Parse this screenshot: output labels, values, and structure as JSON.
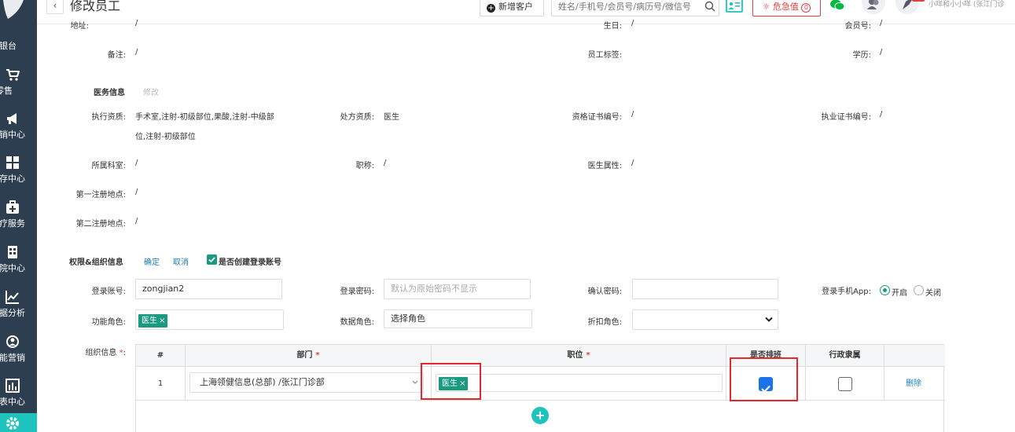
{
  "sidebar": {
    "items": [
      {
        "label": "收银台",
        "icon": "cashier-icon"
      },
      {
        "label": "零售",
        "icon": "cart-icon"
      },
      {
        "label": "营销中心",
        "icon": "megaphone-icon"
      },
      {
        "label": "库存中心",
        "icon": "grid-icon"
      },
      {
        "label": "医疗服务",
        "icon": "medkit-icon"
      },
      {
        "label": "住院中心",
        "icon": "building-icon"
      },
      {
        "label": "数据分析",
        "icon": "chart-line-icon"
      },
      {
        "label": "智能营销",
        "icon": "smart-icon"
      },
      {
        "label": "报表中心",
        "icon": "bar-chart-icon"
      },
      {
        "label": "",
        "icon": "gear-icon"
      }
    ]
  },
  "header": {
    "title": "修改员工",
    "add_customer": "新增客户",
    "search_placeholder": "姓名/手机号/会员号/病历号/微信号",
    "danger_label": "危急值",
    "danger_count": "0",
    "user": "小咩和小小咩 (张江门诊"
  },
  "basic": {
    "row_top": {
      "l1": "地址:",
      "v1": "/",
      "l2": "生日:",
      "v2": "/",
      "l3": "会员号:",
      "v3": "/"
    },
    "remark_label": "备注:",
    "remark_value": "/",
    "tag_label": "员工标签:",
    "edu_label": "学历:",
    "edu_value": "/"
  },
  "medical": {
    "title": "医务信息",
    "edit": "修改",
    "qual_label": "执行资质:",
    "qual_value_line1": "手术室,注射-初级部位,果酸,注射-中级部",
    "qual_value_line2": "位,注射-初级部位",
    "rx_label": "处方资质:",
    "rx_value": "医生",
    "cert_label": "资格证书编号:",
    "cert_value": "/",
    "license_label": "执业证书编号:",
    "license_value": "/",
    "dept_label": "所属科室:",
    "dept_value": "/",
    "title_label": "职称:",
    "title_value": "/",
    "doc_attr_label": "医生属性:",
    "doc_attr_value": "/",
    "reg1_label": "第一注册地点:",
    "reg1_value": "/",
    "reg2_label": "第二注册地点:",
    "reg2_value": "/"
  },
  "perm": {
    "title": "权限&组织信息",
    "confirm": "确定",
    "cancel": "取消",
    "create_account": "是否创建登录账号",
    "account_label": "登录账号:",
    "account_value": "zongjian2",
    "password_label": "登录密码:",
    "password_placeholder": "默认为原始密码不显示",
    "confirm_pw_label": "确认密码:",
    "app_label": "登录手机App:",
    "app_on": "开启",
    "app_off": "关闭",
    "role_label": "功能角色:",
    "role_tag": "医生",
    "data_role_label": "数据角色:",
    "data_role_value": "选择角色",
    "discount_label": "折扣角色:",
    "org_label": "组织信息"
  },
  "table": {
    "headers": {
      "num": "#",
      "dept": "部门",
      "position": "职位",
      "schedule": "是否排班",
      "admin": "行政隶属"
    },
    "row": {
      "num": "1",
      "dept": "上海领健信息(总部)  /张江门诊部",
      "position_tag": "医生",
      "delete": "删除"
    }
  },
  "colors": {
    "accent": "#1ec3bd",
    "tag": "#1a9a80",
    "danger": "#e04040",
    "highlight": "#e8262b",
    "sidebar": "#2d3e50"
  }
}
